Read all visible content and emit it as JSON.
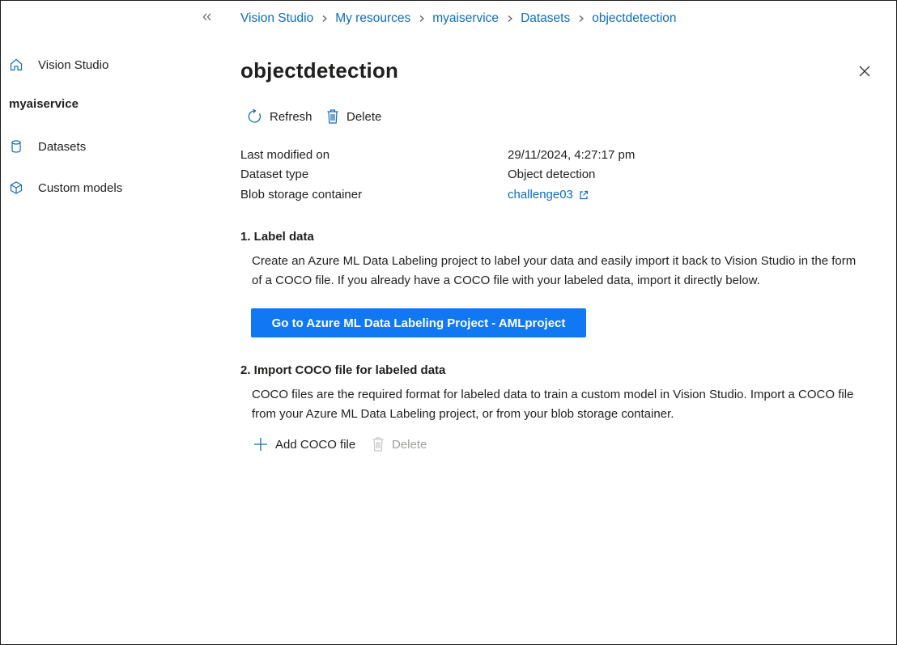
{
  "sidebar": {
    "top_item": {
      "label": "Vision Studio",
      "icon": "home-icon"
    },
    "resource_name": "myaiservice",
    "items": [
      {
        "label": "Datasets",
        "icon": "database-icon"
      },
      {
        "label": "Custom models",
        "icon": "cube-icon"
      }
    ]
  },
  "breadcrumb": [
    "Vision Studio",
    "My resources",
    "myaiservice",
    "Datasets",
    "objectdetection"
  ],
  "page": {
    "title": "objectdetection"
  },
  "toolbar": {
    "refresh_label": "Refresh",
    "delete_label": "Delete"
  },
  "properties": [
    {
      "label": "Last modified on",
      "value": "29/11/2024, 4:27:17 pm"
    },
    {
      "label": "Dataset type",
      "value": "Object detection"
    },
    {
      "label": "Blob storage container",
      "value": "challenge03"
    }
  ],
  "step1": {
    "title": "1. Label data",
    "text_line1": "Create an Azure ML Data Labeling project to label your data and easily import it back to Vision Studio in the form",
    "text_line2": "of a COCO file. If you already have a COCO file with your labeled data, import it directly below.",
    "button_label": "Go to Azure ML Data Labeling Project - AMLproject"
  },
  "step2": {
    "title": "2. Import COCO file for labeled data",
    "text_line1": "COCO files are the required format for labeled data to train a custom model in Vision Studio. Import a COCO file",
    "text_line2": "from your Azure ML Data Labeling project, or from your blob storage container.",
    "add_label": "Add COCO file",
    "delete_label": "Delete"
  },
  "colors": {
    "accent": "#0f78f2",
    "link": "#0f6cbd",
    "disabled": "#a19f9d"
  }
}
